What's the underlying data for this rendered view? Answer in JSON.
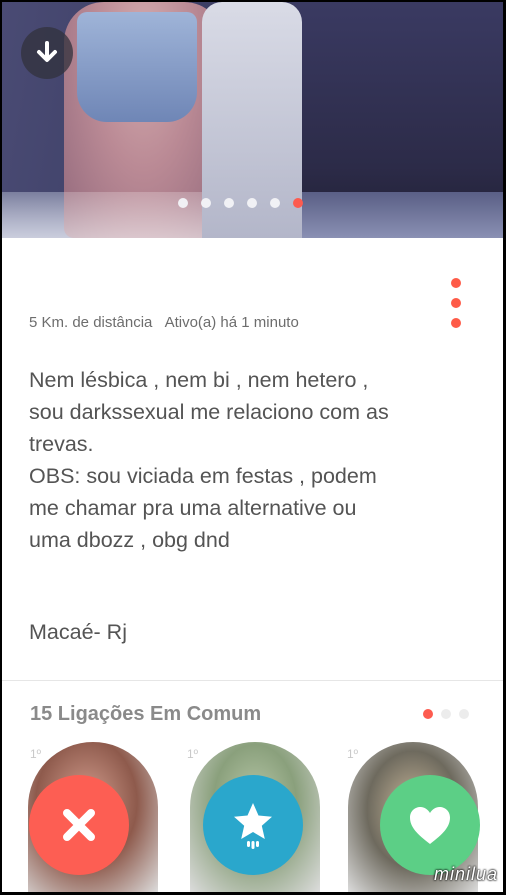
{
  "photo": {
    "dots_total": 6,
    "active_dot_index": 5
  },
  "profile": {
    "distance": "5 Km. de distância",
    "active_status": "Ativo(a) há 1 minuto",
    "bio": "Nem lésbica , nem bi , nem hetero ,\nsou darkssexual me relaciono  com as\ntrevas.\nOBS: sou viciada em festas , podem\nme chamar pra uma alternative ou\numa dbozz , obg dnd",
    "city": "Macaé- Rj"
  },
  "connections": {
    "label": "15 Ligações Em Comum",
    "degree": "1º",
    "pager_total": 3,
    "pager_active_index": 0
  },
  "actions": {
    "nope_icon": "close-icon",
    "superlike_icon": "star-icon",
    "like_icon": "heart-icon"
  },
  "colors": {
    "accent": "#fd5b4f",
    "nope": "#fd5e53",
    "superlike": "#2aa7cc",
    "like": "#5ccf86"
  },
  "watermark": "minilua"
}
